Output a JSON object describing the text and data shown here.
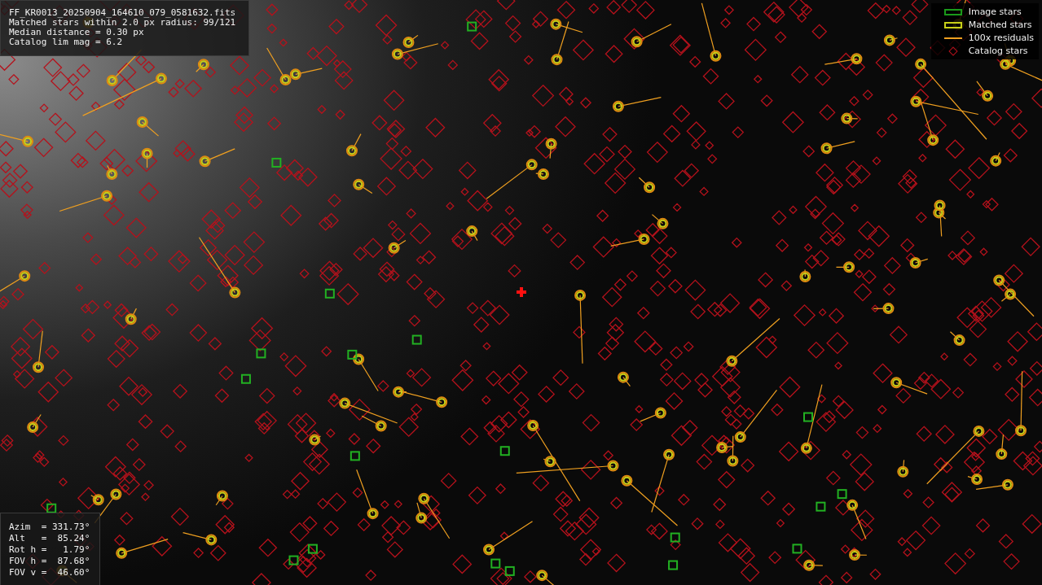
{
  "info_panel": {
    "lines": [
      "FF_KR0013_20250904_164610_079_0581632.fits",
      "Matched stars within 2.0 px radius: 99/121",
      "Median distance = 0.30 px",
      "Catalog lim mag = 6.2"
    ]
  },
  "legend": [
    {
      "kind": "image",
      "label": "Image stars"
    },
    {
      "kind": "matched",
      "label": "Matched stars"
    },
    {
      "kind": "residual",
      "label": "100x residuals"
    },
    {
      "kind": "catalog",
      "label": "Catalog stars"
    }
  ],
  "pointing_panel": {
    "lines": [
      "Azim  = 331.73°",
      "Alt   =  85.24°",
      "Rot h =   1.79°",
      "FOV h =  87.68°",
      "FOV v =  46.60°"
    ]
  }
}
